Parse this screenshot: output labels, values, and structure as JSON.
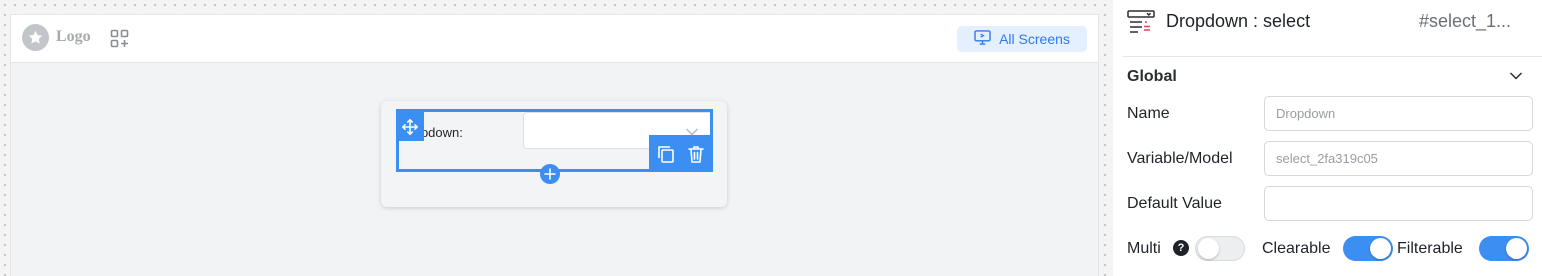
{
  "canvas": {
    "header": {
      "logo_text": "Logo",
      "all_screens_label": "All Screens"
    },
    "form": {
      "dropdown_label": "Dropdown:",
      "dropdown_value": ""
    }
  },
  "panel": {
    "title": "Dropdown : select",
    "component_id": "#select_1...",
    "section_title": "Global",
    "fields": {
      "name": {
        "label": "Name",
        "placeholder": "Dropdown",
        "value": ""
      },
      "variable": {
        "label": "Variable/Model",
        "placeholder": "select_2fa319c05",
        "value": ""
      },
      "default_value": {
        "label": "Default Value",
        "placeholder": "",
        "value": ""
      }
    },
    "toggles": {
      "multi": {
        "label": "Multi",
        "help": "?",
        "on": false
      },
      "clearable": {
        "label": "Clearable",
        "on": true
      },
      "filterable": {
        "label": "Filterable",
        "on": true
      }
    }
  },
  "colors": {
    "accent": "#3b8ef2",
    "accent_light": "#e4efff",
    "canvas_bg": "#f2f3f5"
  },
  "icons": [
    "star-icon",
    "apps-add-icon",
    "monitor-icon",
    "move-icon",
    "copy-icon",
    "trash-icon",
    "plus-icon",
    "chevron-down-icon",
    "select-component-icon",
    "help-icon"
  ]
}
